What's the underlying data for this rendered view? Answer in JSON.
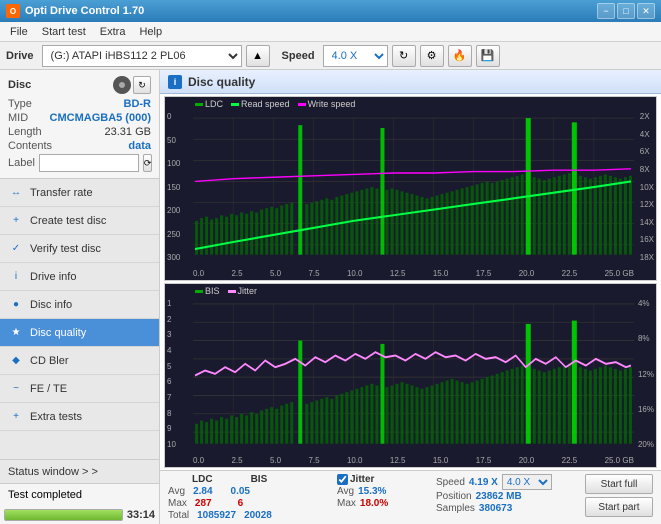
{
  "titlebar": {
    "icon_text": "O",
    "title": "Opti Drive Control 1.70",
    "min_label": "−",
    "max_label": "□",
    "close_label": "✕"
  },
  "menubar": {
    "items": [
      "File",
      "Start test",
      "Extra",
      "Help"
    ]
  },
  "drivebar": {
    "drive_label": "Drive",
    "drive_value": "(G:) ATAPI iHBS112  2 PL06",
    "speed_label": "Speed",
    "speed_value": "4.0 X"
  },
  "disc": {
    "label": "Disc",
    "type_key": "Type",
    "type_val": "BD-R",
    "mid_key": "MID",
    "mid_val": "CMCMAGBA5 (000)",
    "length_key": "Length",
    "length_val": "23.31 GB",
    "contents_key": "Contents",
    "contents_val": "data",
    "label_key": "Label",
    "label_placeholder": ""
  },
  "nav": {
    "items": [
      {
        "id": "transfer-rate",
        "label": "Transfer rate",
        "icon": "↔"
      },
      {
        "id": "create-test-disc",
        "label": "Create test disc",
        "icon": "+"
      },
      {
        "id": "verify-test-disc",
        "label": "Verify test disc",
        "icon": "✓"
      },
      {
        "id": "drive-info",
        "label": "Drive info",
        "icon": "i"
      },
      {
        "id": "disc-info",
        "label": "Disc info",
        "icon": "●"
      },
      {
        "id": "disc-quality",
        "label": "Disc quality",
        "icon": "★",
        "active": true
      },
      {
        "id": "cd-bler",
        "label": "CD Bler",
        "icon": "◆"
      },
      {
        "id": "fe-te",
        "label": "FE / TE",
        "icon": "~"
      },
      {
        "id": "extra-tests",
        "label": "Extra tests",
        "icon": "+"
      }
    ]
  },
  "status": {
    "window_label": "Status window > >",
    "completed_text": "Test completed",
    "progress": 100,
    "time": "33:14"
  },
  "disc_quality": {
    "title": "Disc quality",
    "icon_text": "i",
    "chart1": {
      "legend": [
        {
          "id": "ldc",
          "label": "LDC",
          "color": "#00aa00"
        },
        {
          "id": "read_speed",
          "label": "Read speed",
          "color": "#00ff44"
        },
        {
          "id": "write_speed",
          "label": "Write speed",
          "color": "#ff00ff"
        }
      ],
      "y_labels_left": [
        "300",
        "250",
        "200",
        "150",
        "100",
        "50",
        "0"
      ],
      "y_labels_right": [
        "18X",
        "16X",
        "14X",
        "12X",
        "10X",
        "8X",
        "6X",
        "4X",
        "2X"
      ],
      "x_labels": [
        "0.0",
        "2.5",
        "5.0",
        "7.5",
        "10.0",
        "12.5",
        "15.0",
        "17.5",
        "20.0",
        "22.5",
        "25.0 GB"
      ]
    },
    "chart2": {
      "legend": [
        {
          "id": "bis",
          "label": "BIS",
          "color": "#00aa00"
        },
        {
          "id": "jitter",
          "label": "Jitter",
          "color": "#ff88ff"
        }
      ],
      "y_labels_left": [
        "10",
        "9",
        "8",
        "7",
        "6",
        "5",
        "4",
        "3",
        "2",
        "1"
      ],
      "y_labels_right": [
        "20%",
        "16%",
        "12%",
        "8%",
        "4%"
      ],
      "x_labels": [
        "0.0",
        "2.5",
        "5.0",
        "7.5",
        "10.0",
        "12.5",
        "15.0",
        "17.5",
        "20.0",
        "22.5",
        "25.0 GB"
      ]
    },
    "stats": {
      "ldc_header": "LDC",
      "bis_header": "BIS",
      "jitter_label": "Jitter",
      "speed_label": "Speed",
      "speed_val": "4.19 X",
      "speed_select": "4.0 X",
      "position_label": "Position",
      "position_val": "23862 MB",
      "samples_label": "Samples",
      "samples_val": "380673",
      "avg_key": "Avg",
      "avg_ldc": "2.84",
      "avg_bis": "0.05",
      "avg_jitter": "15.3%",
      "max_key": "Max",
      "max_ldc": "287",
      "max_bis": "6",
      "max_jitter": "18.0%",
      "total_key": "Total",
      "total_ldc": "1085927",
      "total_bis": "20028",
      "start_full_label": "Start full",
      "start_part_label": "Start part"
    }
  }
}
